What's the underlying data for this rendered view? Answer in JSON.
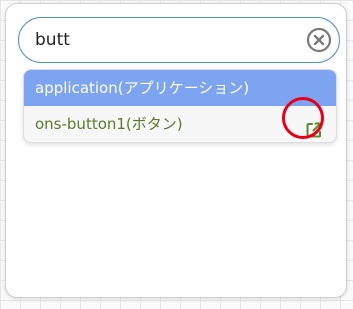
{
  "search": {
    "value": "butt",
    "clear_icon": "clear-circle-x-icon"
  },
  "results": [
    {
      "label": "application(アプリケーション)",
      "state": "highlighted"
    },
    {
      "label": "ons-button1(ボタン)",
      "action_icon": "external-link-icon"
    }
  ],
  "annotation": {
    "marker": "red circle around open-in-new icon"
  },
  "colors": {
    "accent_border": "#4a90e2",
    "highlight_bg": "#7ca4f0",
    "result_text": "#5a7b2a",
    "icon_green": "#5b8a2c",
    "marker_red": "#e8001a"
  }
}
